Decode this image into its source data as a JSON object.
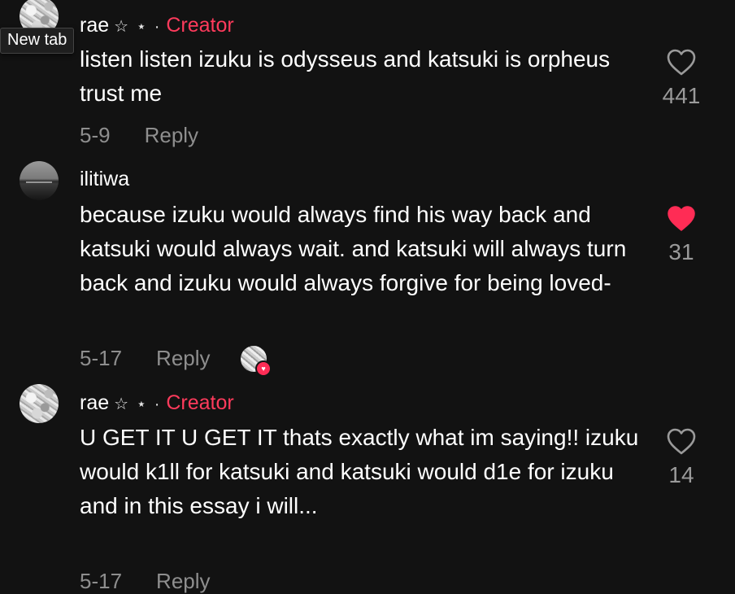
{
  "tooltip": {
    "text": "New tab"
  },
  "comments": [
    {
      "username": "rae",
      "decoration": "☆ ⋆ ·",
      "badge": "Creator",
      "text": "listen listen izuku is odysseus and katsuki is orpheus trust me",
      "date": "5-9",
      "reply_label": "Reply",
      "likes": "441",
      "liked": false
    },
    {
      "username": "ilitiwa",
      "decoration": "",
      "badge": "",
      "text": "because izuku would always find his way back and katsuki would always wait. and katsuki will always turn back and izuku would always forgive for being loved-",
      "date": "5-17",
      "reply_label": "Reply",
      "likes": "31",
      "liked": true,
      "liked_by_creator": true
    },
    {
      "username": "rae",
      "decoration": "☆ ⋆ ·",
      "badge": "Creator",
      "text": "U GET IT U GET IT thats exactly what im saying!! izuku would k1ll for katsuki and katsuki would d1e for izuku and in this essay i will...",
      "date": "5-17",
      "reply_label": "Reply",
      "likes": "14",
      "liked": false
    }
  ],
  "colors": {
    "background": "#121212",
    "creator": "#ff3b5c",
    "liked_heart": "#ff2c55",
    "meta": "#8e8e8e"
  }
}
